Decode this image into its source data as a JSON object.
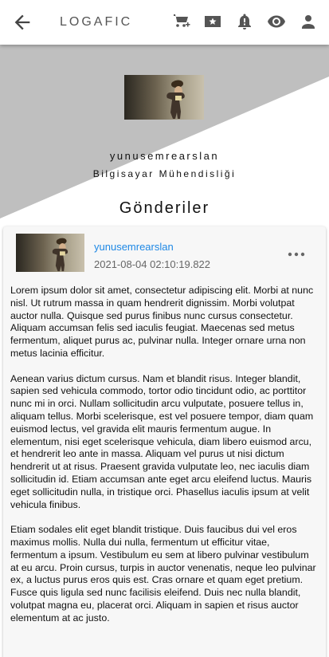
{
  "appbar": {
    "title": "LOGAFIC",
    "icons": [
      "back-arrow-icon",
      "add-shopping-cart-icon",
      "star-card-icon",
      "bell-alert-icon",
      "eye-icon",
      "person-icon"
    ]
  },
  "colors": {
    "header_gray": "#bfbfbf",
    "link_blue": "#1e88e5",
    "card_bg": "#f7f7f7"
  },
  "profile": {
    "username": "yunusemrearslan",
    "department": "Bilgisayar Mühendisliği"
  },
  "section": {
    "title": "Gönderiler"
  },
  "post": {
    "author": "yunusemrearslan",
    "date": "2021-08-04 02:10:19.822",
    "paragraphs": [
      "Lorem ipsum dolor sit amet, consectetur adipiscing elit. Morbi at nunc nisl. Ut rutrum massa in quam hendrerit dignissim. Morbi volutpat auctor nulla. Quisque sed purus finibus nunc cursus consectetur. Aliquam accumsan felis sed iaculis feugiat. Maecenas sed metus fermentum, aliquet purus ac, pulvinar nulla. Integer ornare urna non metus lacinia efficitur.",
      "Aenean varius dictum cursus. Nam et blandit risus. Integer blandit, sapien sed vehicula commodo, tortor odio tincidunt odio, ac porttitor nunc mi in orci. Nullam sollicitudin arcu vulputate, posuere tellus in, aliquam tellus. Morbi scelerisque, est vel posuere tempor, diam quam euismod lectus, vel gravida elit mauris fermentum augue. In elementum, nisi eget scelerisque vehicula, diam libero euismod arcu, et hendrerit leo ante in massa. Aliquam vel purus ut nisi dictum hendrerit ut at risus. Praesent gravida vulputate leo, nec iaculis diam sollicitudin id. Etiam accumsan ante eget arcu eleifend luctus. Mauris eget sollicitudin nulla, in tristique orci. Phasellus iaculis ipsum at velit vehicula finibus.",
      "Etiam sodales elit eget blandit tristique. Duis faucibus dui vel eros maximus mollis. Nulla dui nulla, fermentum ut efficitur vitae, fermentum a ipsum. Vestibulum eu sem at libero pulvinar vestibulum at eu arcu. Proin cursus, turpis in auctor venenatis, neque leo pulvinar ex, a luctus purus eros quis est. Cras ornare et quam eget pretium. Fusce quis ligula sed nunc facilisis eleifend. Duis nec nulla blandit, volutpat magna eu, placerat orci. Aliquam in sapien et risus auctor elementum at ac justo."
    ]
  }
}
